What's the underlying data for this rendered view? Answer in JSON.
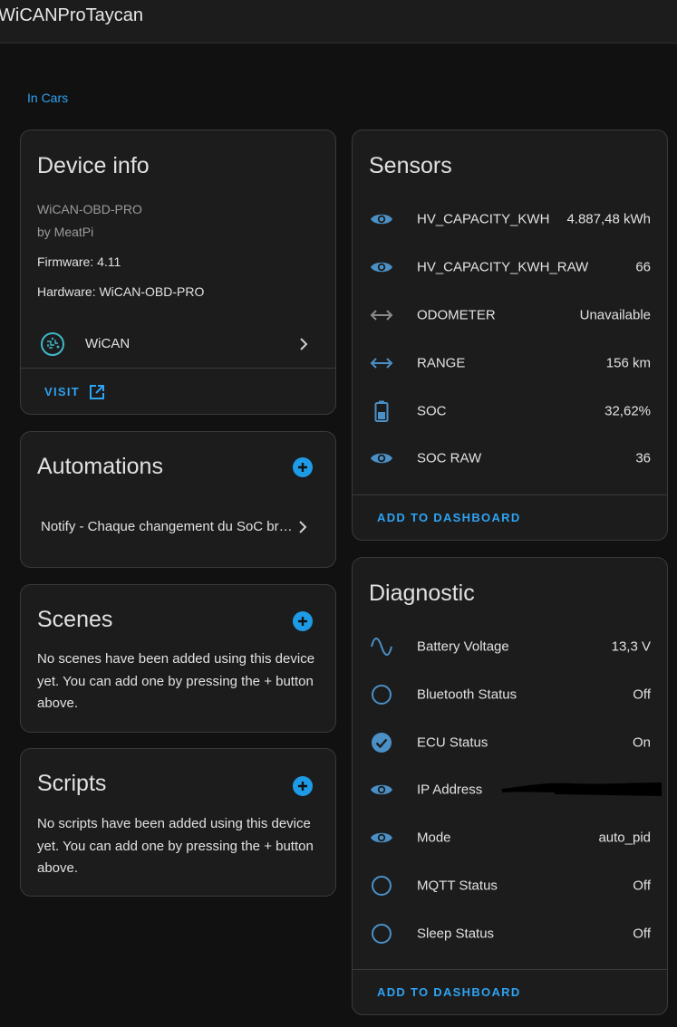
{
  "header": {
    "title": "WiCANProTaycan"
  },
  "breadcrumb": {
    "area": "In Cars"
  },
  "device_info": {
    "title": "Device info",
    "model": "WiCAN-OBD-PRO",
    "manufacturer": "by MeatPi",
    "firmware": "Firmware: 4.11",
    "hardware": "Hardware: WiCAN-OBD-PRO",
    "integration": "WiCAN",
    "visit_label": "VISIT"
  },
  "automations": {
    "title": "Automations",
    "items": [
      {
        "label": "Notify - Chaque changement du SoC br…"
      }
    ]
  },
  "scenes": {
    "title": "Scenes",
    "empty_text": "No scenes have been added using this device yet. You can add one by pressing the + button above."
  },
  "scripts": {
    "title": "Scripts",
    "empty_text": "No scripts have been added using this device yet. You can add one by pressing the + button above."
  },
  "sensors": {
    "title": "Sensors",
    "rows": [
      {
        "name": "HV_CAPACITY_KWH",
        "value": "4.887,48 kWh",
        "icon": "eye-icon"
      },
      {
        "name": "HV_CAPACITY_KWH_RAW",
        "value": "66",
        "icon": "eye-icon"
      },
      {
        "name": "ODOMETER",
        "value": "Unavailable",
        "icon": "arrow-left-right-icon"
      },
      {
        "name": "RANGE",
        "value": "156 km",
        "icon": "arrow-left-right-icon"
      },
      {
        "name": "SOC",
        "value": "32,62%",
        "icon": "battery-icon"
      },
      {
        "name": "SOC RAW",
        "value": "36",
        "icon": "eye-icon"
      }
    ],
    "add_label": "ADD TO DASHBOARD"
  },
  "diagnostic": {
    "title": "Diagnostic",
    "rows": [
      {
        "name": "Battery Voltage",
        "value": "13,3 V",
        "icon": "sine-wave-icon"
      },
      {
        "name": "Bluetooth Status",
        "value": "Off",
        "icon": "circle-outline-icon"
      },
      {
        "name": "ECU Status",
        "value": "On",
        "icon": "check-circle-icon"
      },
      {
        "name": "IP Address",
        "value": "",
        "icon": "eye-icon"
      },
      {
        "name": "Mode",
        "value": "auto_pid",
        "icon": "eye-icon"
      },
      {
        "name": "MQTT Status",
        "value": "Off",
        "icon": "circle-outline-icon"
      },
      {
        "name": "Sleep Status",
        "value": "Off",
        "icon": "circle-outline-icon"
      }
    ],
    "add_label": "ADD TO DASHBOARD"
  },
  "colors": {
    "accent": "#2ea3f2",
    "icon_blue": "#4a90c7",
    "icon_grey": "#8a8a8a",
    "card_bg": "#1c1c1c",
    "page_bg": "#111111"
  }
}
